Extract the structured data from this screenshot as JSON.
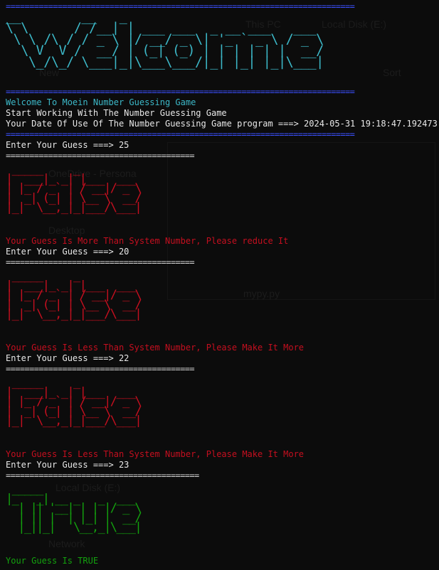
{
  "colors": {
    "background": "#0c0c0c",
    "banner_blue": "#3b50ff",
    "welcome_cyan": "#3cb8c8",
    "text_white": "#e8e8e8",
    "error_red": "#c50f1f",
    "success_green": "#13a10e"
  },
  "background_window": {
    "breadcrumb": [
      "This PC",
      "Local Disk (E:)"
    ],
    "new_label": "New",
    "sort_label": "Sort",
    "sidebar": [
      "OneDrive - Persona",
      "Desktop",
      "Local Disk (E:)",
      "Network"
    ],
    "file_label": "mypy.py"
  },
  "banner": {
    "separator": "==========================================================================",
    "welcome_art": "__        __   _                          \n\\ \\      / /__| | ___ ___  _ __ ___   ___ \n \\ \\ /\\ / / _ \\ |/ __/ _ \\| '_ ` _ \\ / _ \\\n  \\ V  V /  __/ | (_| (_) | | | | | |  __/\n   \\_/\\_/ \\___|_|\\___\\___/|_| |_| |_|\\___|",
    "welcome_line": "Welcome To Moein Number Guessing Game",
    "start_line": "Start Working With The Number Guessing Game",
    "date_line": "Your Date Of Use Of The Number Guessing Game program ===> 2024-05-31 19:18:47.192473"
  },
  "attempts": [
    {
      "prompt": "Enter Your Guess ===> 25",
      "separator": "========================================",
      "result_art": " _____     _          \n|  ___|_ _| |___  ___ \n| |_ / _` | / __|/ _ \\\n|  _| (_| | \\__ \\  __/\n|_|  \\__,_|_|___/\\___|",
      "message": "Your Guess Is More Than System Number, Please reduce It"
    },
    {
      "prompt": "Enter Your Guess ===> 20",
      "separator": "========================================",
      "result_art": " _____     _          \n|  ___|_ _| |___  ___ \n| |_ / _` | / __|/ _ \\\n|  _| (_| | \\__ \\  __/\n|_|  \\__,_|_|___/\\___|",
      "message": "Your Guess Is Less Than System Number, Please Make It More"
    },
    {
      "prompt": "Enter Your Guess ===> 22",
      "separator": "========================================",
      "result_art": " _____     _          \n|  ___|_ _| |___  ___ \n| |_ / _` | / __|/ _ \\\n|  _| (_| | \\__ \\  __/\n|_|  \\__,_|_|___/\\___|",
      "message": "Your Guess Is Less Than System Number, Please Make It More"
    },
    {
      "prompt": "Enter Your Guess ===> 23",
      "separator": "=========================================",
      "result_art": " _____                \n|_   _| __ _   _  ___ \n  | || '__| | | |/ _ \\\n  | || |  | |_| |  __/\n  |_||_|   \\__,_|\\___|",
      "message": "Your Guess Is TRUE"
    }
  ]
}
